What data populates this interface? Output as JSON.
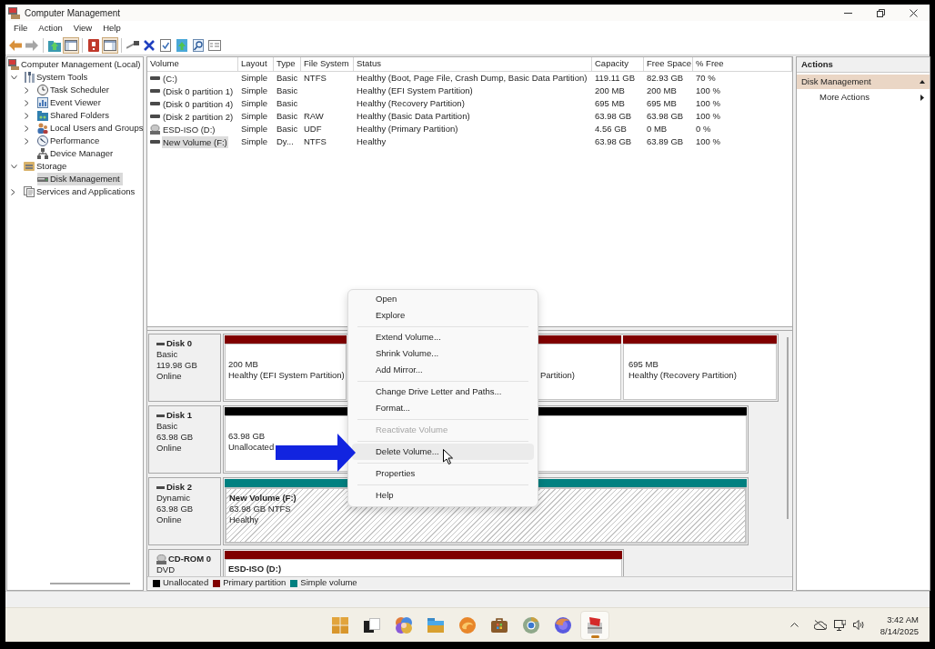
{
  "window": {
    "title": "Computer Management"
  },
  "menu_bar": [
    "File",
    "Action",
    "View",
    "Help"
  ],
  "toolbar": [
    {
      "pressed": false
    },
    {
      "pressed": false
    },
    {
      "pressed": false
    },
    {
      "pressed": true
    },
    {
      "pressed": false
    },
    {
      "pressed": true
    },
    {
      "pressed": false
    },
    {
      "pressed": false
    },
    {
      "pressed": false
    },
    {
      "pressed": false
    },
    {
      "pressed": false
    },
    {
      "pressed": false
    }
  ],
  "tree": [
    {
      "label": "Computer Management (Local)",
      "selected": false,
      "children": [
        {
          "label": "System Tools",
          "expanded": true,
          "selected": false,
          "children": [
            {
              "label": "Task Scheduler",
              "expanded": false,
              "selected": false
            },
            {
              "label": "Event Viewer",
              "expanded": false,
              "selected": false
            },
            {
              "label": "Shared Folders",
              "expanded": false,
              "selected": false
            },
            {
              "label": "Local Users and Groups",
              "expanded": false,
              "selected": false
            },
            {
              "label": "Performance",
              "expanded": false,
              "selected": false
            },
            {
              "label": "Device Manager",
              "selected": false
            }
          ]
        },
        {
          "label": "Storage",
          "expanded": true,
          "selected": false,
          "children": [
            {
              "label": "Disk Management",
              "selected": true
            }
          ]
        },
        {
          "label": "Services and Applications",
          "expanded": false,
          "selected": false
        }
      ]
    }
  ],
  "volumes": {
    "columns": [
      "Volume",
      "Layout",
      "Type",
      "File System",
      "Status",
      "Capacity",
      "Free Space",
      "% Free"
    ],
    "rows": [
      {
        "kind": "disk",
        "selected": false,
        "volume": "(C:)",
        "layout": "Simple",
        "type": "Basic",
        "file_system": "NTFS",
        "status": "Healthy (Boot, Page File, Crash Dump, Basic Data Partition)",
        "capacity": "119.11 GB",
        "free_space": "82.93 GB",
        "percent_free": "70 %"
      },
      {
        "kind": "disk",
        "selected": false,
        "volume": "(Disk 0 partition 1)",
        "layout": "Simple",
        "type": "Basic",
        "status": "Healthy (EFI System Partition)",
        "capacity": "200 MB",
        "free_space": "200 MB",
        "percent_free": "100 %"
      },
      {
        "kind": "disk",
        "selected": false,
        "volume": "(Disk 0 partition 4)",
        "layout": "Simple",
        "type": "Basic",
        "status": "Healthy (Recovery Partition)",
        "capacity": "695 MB",
        "free_space": "695 MB",
        "percent_free": "100 %"
      },
      {
        "kind": "disk",
        "selected": false,
        "volume": "(Disk 2 partition 2)",
        "layout": "Simple",
        "type": "Basic",
        "file_system": "RAW",
        "status": "Healthy (Basic Data Partition)",
        "capacity": "63.98 GB",
        "free_space": "63.98 GB",
        "percent_free": "100 %"
      },
      {
        "kind": "cdrom",
        "selected": false,
        "volume": "ESD-ISO (D:)",
        "layout": "Simple",
        "type": "Basic",
        "file_system": "UDF",
        "status": "Healthy (Primary Partition)",
        "capacity": "4.56 GB",
        "free_space": "0 MB",
        "percent_free": "0 %"
      },
      {
        "kind": "disk",
        "selected": true,
        "volume": "New Volume (F:)",
        "layout": "Simple",
        "type": "Dy...",
        "file_system": "NTFS",
        "status": "Healthy",
        "capacity": "63.98 GB",
        "free_space": "63.89 GB",
        "percent_free": "100 %"
      }
    ]
  },
  "disks": [
    {
      "kind": "disk",
      "name": "Disk 0",
      "type": "Basic",
      "size": "119.98 GB",
      "status": "Online",
      "partitions": [
        {
          "color": "#800000",
          "selected": false,
          "size": "200 MB",
          "status": "Healthy (EFI System Partition)"
        },
        {
          "color": "#800000",
          "selected": false,
          "status": "Partition)"
        },
        {
          "color": "#800000",
          "selected": false,
          "size": "695 MB",
          "status": "Healthy (Recovery Partition)"
        }
      ]
    },
    {
      "kind": "disk",
      "name": "Disk 1",
      "type": "Basic",
      "size": "63.98 GB",
      "status": "Online",
      "partitions": [
        {
          "color": "#000000",
          "selected": false,
          "size": "63.98 GB",
          "status": "Unallocated"
        }
      ]
    },
    {
      "kind": "disk",
      "name": "Disk 2",
      "type": "Dynamic",
      "size": "63.98 GB",
      "status": "Online",
      "partitions": [
        {
          "color": "#008080",
          "selected": true,
          "name": "New Volume  (F:)",
          "size": "63.98 GB NTFS",
          "status": "Healthy"
        }
      ]
    },
    {
      "kind": "cdrom",
      "name": "CD-ROM 0",
      "type": "DVD",
      "partitions": [
        {
          "color": "#800000",
          "selected": false,
          "name": "ESD-ISO  (D:)"
        }
      ]
    }
  ],
  "legend": [
    {
      "label": "Unallocated",
      "color": "#000000"
    },
    {
      "label": "Primary partition",
      "color": "#800000"
    },
    {
      "label": "Simple volume",
      "color": "#008080"
    }
  ],
  "context_menu": {
    "groups": [
      [
        {
          "label": "Open",
          "disabled": false,
          "selected": false
        },
        {
          "label": "Explore",
          "disabled": false,
          "selected": false
        }
      ],
      [
        {
          "label": "Extend Volume...",
          "disabled": false,
          "selected": false
        },
        {
          "label": "Shrink Volume...",
          "disabled": false,
          "selected": false
        },
        {
          "label": "Add Mirror...",
          "disabled": false,
          "selected": false
        }
      ],
      [
        {
          "label": "Change Drive Letter and Paths...",
          "disabled": false,
          "selected": false
        },
        {
          "label": "Format...",
          "disabled": false,
          "selected": false
        }
      ],
      [
        {
          "label": "Reactivate Volume",
          "disabled": true,
          "selected": false
        }
      ],
      [
        {
          "label": "Delete Volume...",
          "disabled": false,
          "selected": true
        }
      ],
      [
        {
          "label": "Properties",
          "disabled": false,
          "selected": false
        }
      ],
      [
        {
          "label": "Help",
          "disabled": false,
          "selected": false
        }
      ]
    ]
  },
  "actions": {
    "title": "Actions",
    "sections": [
      {
        "label": "Disk Management",
        "expanded": true,
        "items": [
          "More Actions"
        ]
      }
    ]
  },
  "taskbar": {
    "apps": [
      {
        "active": false
      },
      {
        "active": false
      },
      {
        "active": false
      },
      {
        "active": false
      },
      {
        "active": false
      },
      {
        "active": false
      },
      {
        "active": false
      },
      {
        "active": false
      },
      {
        "active": true
      }
    ],
    "time": "3:42 AM",
    "date": "8/14/2025"
  }
}
